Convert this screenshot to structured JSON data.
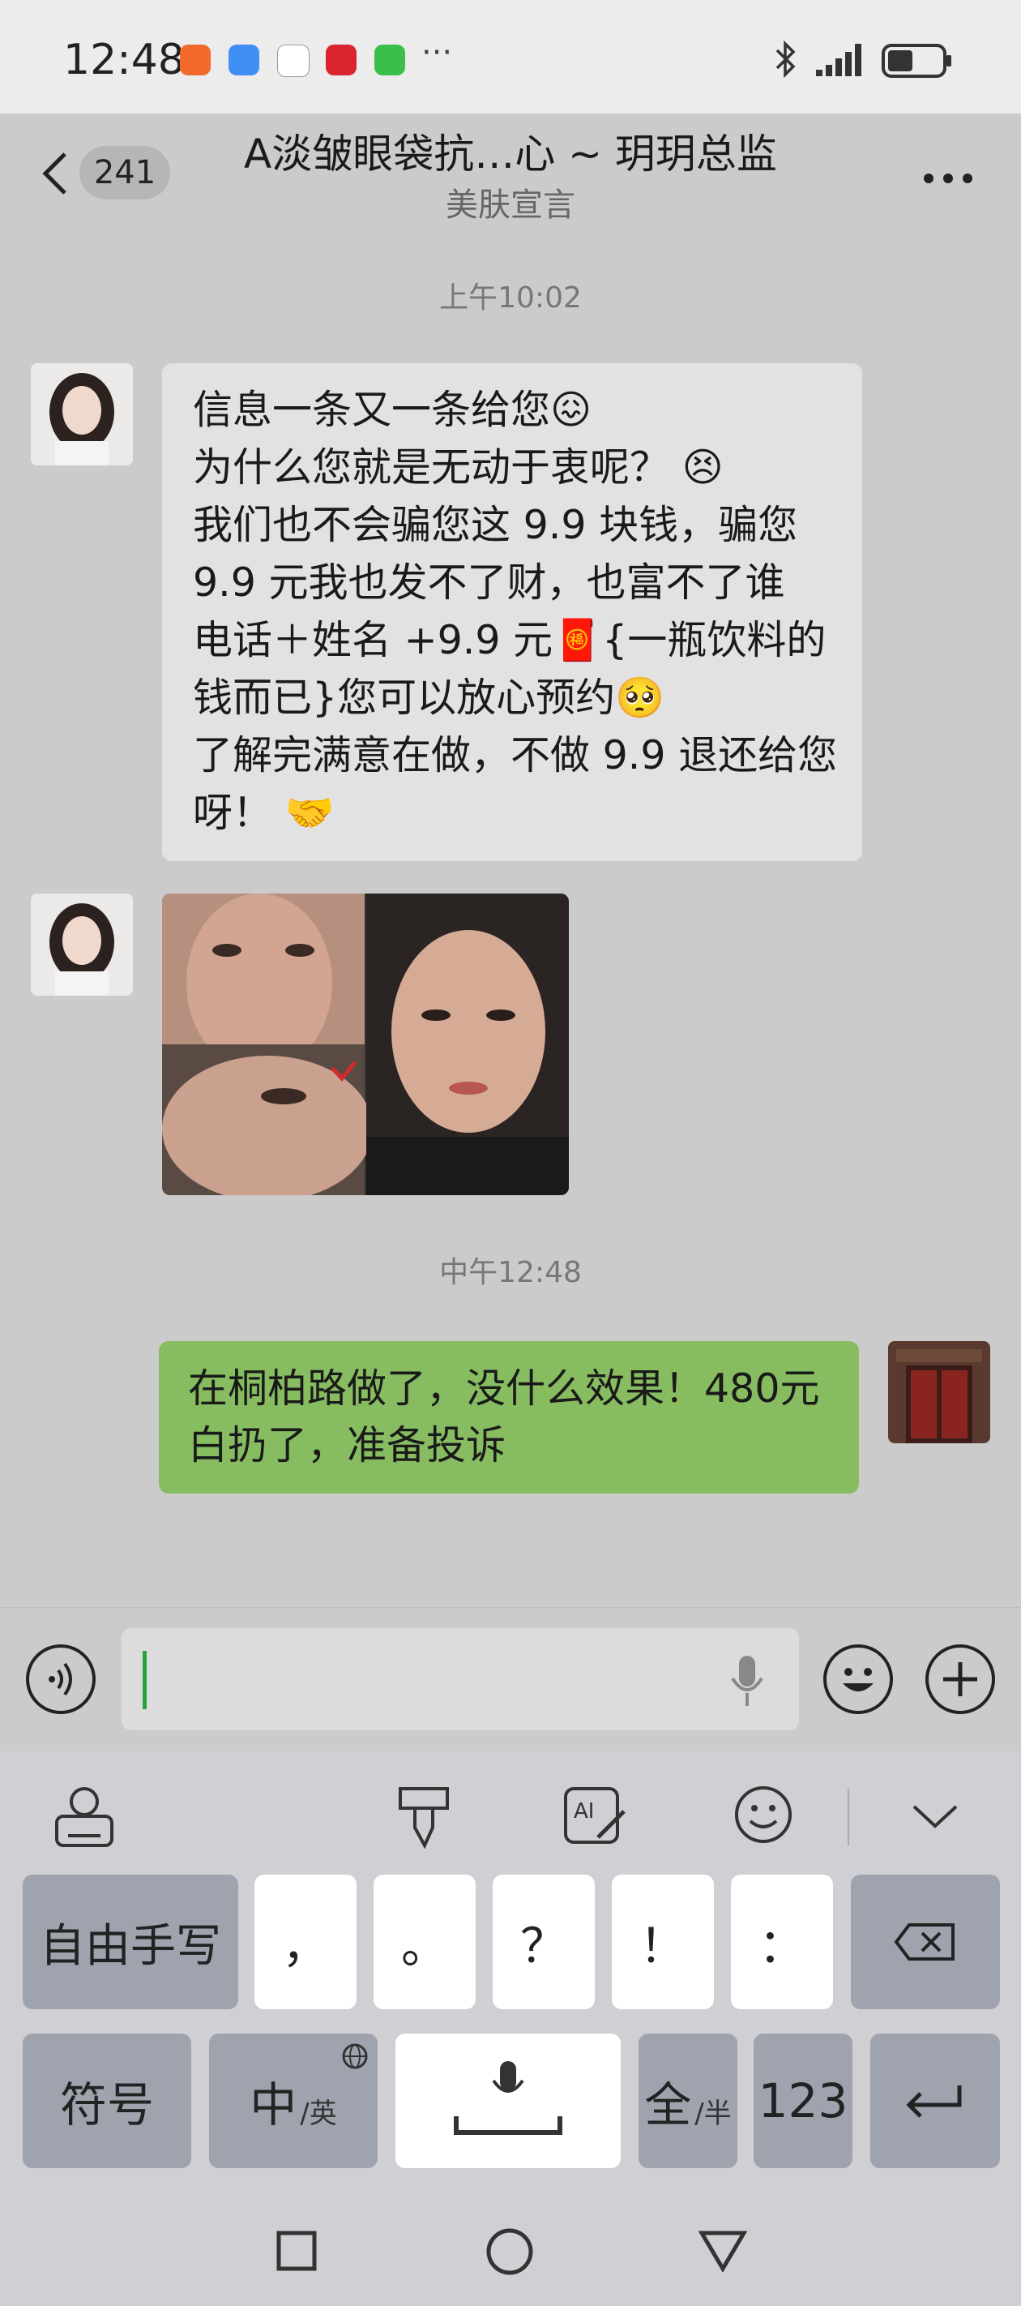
{
  "status_bar": {
    "time": "12:48",
    "overflow": "···",
    "icons": [
      "kuaishou-app-icon",
      "messages-app-icon",
      "tiktok-app-icon",
      "news-app-icon",
      "wechat-app-icon",
      "bluetooth-icon",
      "signal-icon",
      "battery-icon"
    ]
  },
  "header": {
    "back_count": "241",
    "title": "A淡皱眼袋抗…心 ~ 玥玥总监",
    "subtitle": "美肤宣言"
  },
  "messages": [
    {
      "type": "timestamp",
      "text": "上午10:02"
    },
    {
      "type": "incoming",
      "sender": "beauty-advisor",
      "text": "信息一条又一条给您😖\n为什么您就是无动于衷呢？ 😣\n我们也不会骗您这 9.9 块钱，骗您 9.9 元我也发不了财，也富不了谁\n电话＋姓名 +9.9 元🧧{一瓶饮料的钱而已}您可以放心预约🥺\n了解完满意在做，不做 9.9 退还给您呀！ 🤝"
    },
    {
      "type": "incoming-image",
      "sender": "beauty-advisor"
    },
    {
      "type": "timestamp",
      "text": "中午12:48"
    },
    {
      "type": "outgoing",
      "text": "在桐柏路做了，没什么效果！480元白扔了，准备投诉"
    }
  ],
  "keyboard": {
    "row1": [
      "自由手写",
      "，",
      "。",
      "？",
      "！",
      "："
    ],
    "row2": {
      "symbols": "符号",
      "zh": "中",
      "zh_sub": "/英",
      "full": "全",
      "full_sub": "/半",
      "num": "123"
    }
  },
  "colors": {
    "incoming_bubble": "#e2e2e2",
    "outgoing_bubble": "#87bd60",
    "background": "#cbcbcb",
    "caret": "#2aa13b"
  }
}
